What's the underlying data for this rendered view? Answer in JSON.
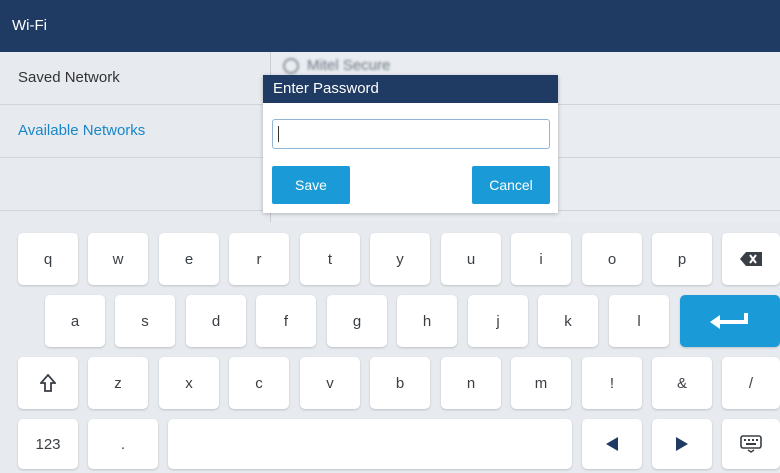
{
  "header": {
    "title": "Wi-Fi"
  },
  "sidebar": {
    "items": [
      {
        "label": "Saved Network"
      },
      {
        "label": "Available Networks"
      }
    ]
  },
  "right_peek": {
    "text": "Mitel Secure"
  },
  "dialog": {
    "title": "Enter Password",
    "input_value": "",
    "save_label": "Save",
    "cancel_label": "Cancel"
  },
  "keyboard": {
    "row1": [
      "q",
      "w",
      "e",
      "r",
      "t",
      "y",
      "u",
      "i",
      "o",
      "p"
    ],
    "row2": [
      "a",
      "s",
      "d",
      "f",
      "g",
      "h",
      "j",
      "k",
      "l"
    ],
    "row3": [
      "z",
      "x",
      "c",
      "v",
      "b",
      "n",
      "m",
      "!",
      "&",
      "/"
    ],
    "numbers_label": "123",
    "period_label": ".",
    "icons": {
      "backspace": "backspace-icon",
      "enter": "enter-icon",
      "shift": "shift-icon",
      "left": "left-arrow-icon",
      "right": "right-arrow-icon",
      "keyboard": "keyboard-icon"
    }
  },
  "colors": {
    "header": "#1f3a63",
    "accent": "#1a9bd7",
    "active_text": "#1a86c9"
  }
}
